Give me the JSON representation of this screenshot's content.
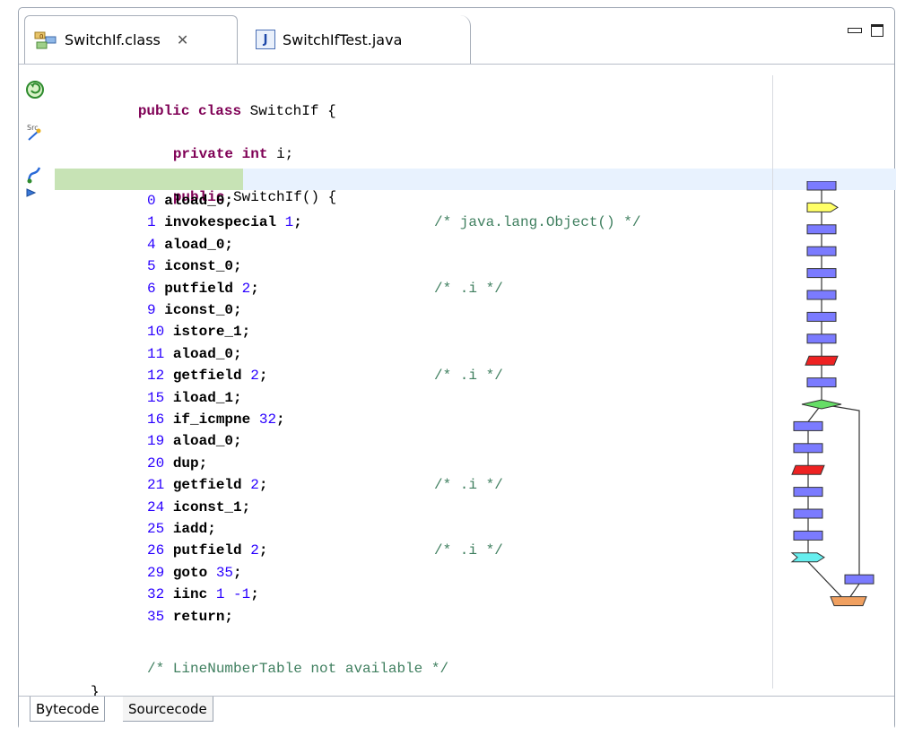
{
  "tabs": {
    "active": {
      "label": "SwitchIf.class",
      "icon": "class-file-icon",
      "close_icon": "close-icon"
    },
    "inactive": {
      "label": "SwitchIfTest.java",
      "icon": "java-file-icon"
    }
  },
  "window_controls": {
    "minimize_icon": "minimize-icon",
    "maximize_icon": "maximize-icon"
  },
  "code": {
    "class_decl": {
      "kw1": "public",
      "kw2": "class",
      "name": "SwitchIf {"
    },
    "field_decl": {
      "kw1": "private",
      "kw2": "int",
      "name": "i;"
    },
    "ctor_decl": {
      "kw1": "public",
      "name": "SwitchIf() {"
    },
    "instructions": [
      {
        "offset": "0",
        "op": "aload_0;",
        "arg": "",
        "comment": ""
      },
      {
        "offset": "1",
        "op": "invokespecial",
        "arg": "1",
        "suffix": ";",
        "comment": "/* java.lang.Object() */"
      },
      {
        "offset": "4",
        "op": "aload_0;",
        "arg": "",
        "comment": ""
      },
      {
        "offset": "5",
        "op": "iconst_0;",
        "arg": "",
        "comment": ""
      },
      {
        "offset": "6",
        "op": "putfield",
        "arg": "2",
        "suffix": ";",
        "comment": "/* .i */"
      },
      {
        "offset": "9",
        "op": "iconst_0;",
        "arg": "",
        "comment": ""
      },
      {
        "offset": "10",
        "op": "istore_1;",
        "arg": "",
        "comment": ""
      },
      {
        "offset": "11",
        "op": "aload_0;",
        "arg": "",
        "comment": ""
      },
      {
        "offset": "12",
        "op": "getfield",
        "arg": "2",
        "suffix": ";",
        "comment": "/* .i */"
      },
      {
        "offset": "15",
        "op": "iload_1;",
        "arg": "",
        "comment": ""
      },
      {
        "offset": "16",
        "op": "if_icmpne",
        "arg": "32",
        "suffix": ";",
        "comment": ""
      },
      {
        "offset": "19",
        "op": "aload_0;",
        "arg": "",
        "comment": ""
      },
      {
        "offset": "20",
        "op": "dup;",
        "arg": "",
        "comment": ""
      },
      {
        "offset": "21",
        "op": "getfield",
        "arg": "2",
        "suffix": ";",
        "comment": "/* .i */"
      },
      {
        "offset": "24",
        "op": "iconst_1;",
        "arg": "",
        "comment": ""
      },
      {
        "offset": "25",
        "op": "iadd;",
        "arg": "",
        "comment": ""
      },
      {
        "offset": "26",
        "op": "putfield",
        "arg": "2",
        "suffix": ";",
        "comment": "/* .i */"
      },
      {
        "offset": "29",
        "op": "goto",
        "arg": "35",
        "suffix": ";",
        "comment": ""
      },
      {
        "offset": "32",
        "op": "iinc",
        "arg": "1 -1",
        "suffix": ";",
        "comment": ""
      },
      {
        "offset": "35",
        "op": "return;",
        "arg": "",
        "comment": ""
      }
    ],
    "linenumber_comment": "/* LineNumberTable not available */",
    "closing_brace": "}"
  },
  "bottom_tabs": {
    "bytecode": "Bytecode",
    "sourcecode": "Sourcecode"
  },
  "colors": {
    "block": "#7b7bff",
    "block_call": "#ffff66",
    "block_field_read": "#ee2222",
    "block_branch": "#66dd66",
    "block_goto": "#66eeee",
    "block_return": "#f0a060",
    "highlight_row": "#e8f2fe",
    "highlight_gutter": "#c7e3b5"
  }
}
